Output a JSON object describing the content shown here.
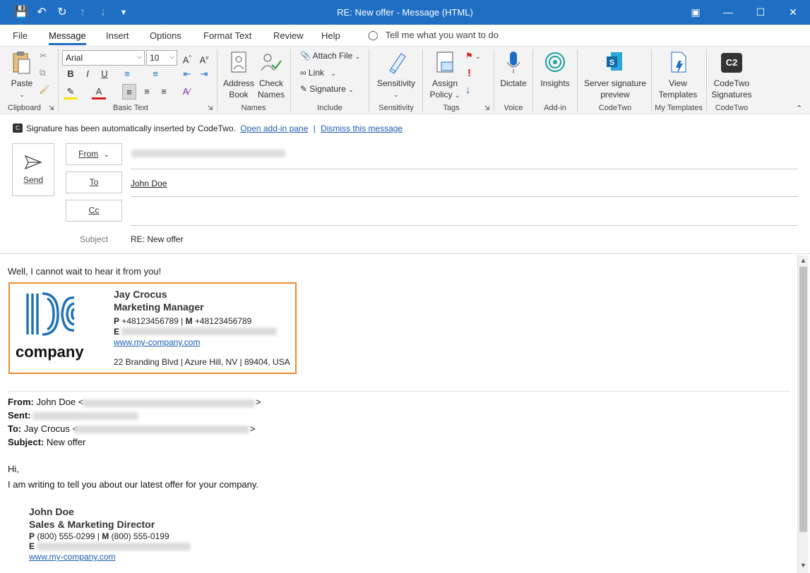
{
  "window": {
    "title": "RE: New offer  -  Message (HTML)"
  },
  "tabs": [
    "File",
    "Message",
    "Insert",
    "Options",
    "Format Text",
    "Review",
    "Help"
  ],
  "tell_me": "Tell me what you want to do",
  "ribbon": {
    "clipboard": {
      "paste": "Paste",
      "group": "Clipboard"
    },
    "basic_text": {
      "font": "Arial",
      "size": "10",
      "group": "Basic Text",
      "bold": "B",
      "italic": "I",
      "underline": "U"
    },
    "names": {
      "address_book_1": "Address",
      "address_book_2": "Book",
      "check_names_1": "Check",
      "check_names_2": "Names",
      "group": "Names"
    },
    "include": {
      "attach_file": "Attach File",
      "link": "Link",
      "signature": "Signature",
      "group": "Include"
    },
    "sensitivity": {
      "label": "Sensitivity",
      "group": "Sensitivity"
    },
    "tags": {
      "assign_1": "Assign",
      "assign_2": "Policy",
      "group": "Tags"
    },
    "voice": {
      "dictate": "Dictate",
      "group": "Voice"
    },
    "addin": {
      "insights": "Insights",
      "group": "Add-in"
    },
    "codetwo": {
      "preview_1": "Server signature",
      "preview_2": "preview",
      "group": "CodeTwo"
    },
    "mytemplates": {
      "view_1": "View",
      "view_2": "Templates",
      "group": "My Templates"
    },
    "codetwo2": {
      "sig_1": "CodeTwo",
      "sig_2": "Signatures",
      "group": "CodeTwo",
      "logo": "C2"
    }
  },
  "infobar": {
    "message": "Signature has been automatically inserted by CodeTwo.",
    "open_link": "Open add-in pane",
    "sep": "|",
    "dismiss_link": "Dismiss this message"
  },
  "compose": {
    "send": "Send",
    "from": "From",
    "to": "To",
    "cc": "Cc",
    "to_value": "John Doe",
    "subject_label": "Subject",
    "subject_value": "RE: New offer"
  },
  "body": {
    "greeting_line": "Well, I cannot wait to hear it from you!",
    "signature": {
      "logo_text": "company",
      "name": "Jay Crocus",
      "title": "Marketing Manager",
      "p_label": "P",
      "phone": "+48123456789",
      "m_label": "M",
      "mobile": "+48123456789",
      "e_label": "E",
      "website": "www.my-company.com",
      "address": "22 Branding Blvd | Azure Hill, NV | 89404, USA"
    },
    "quoted": {
      "from_label": "From:",
      "from_value": "John Doe <",
      "sent_label": "Sent:",
      "to_label": "To:",
      "to_value": "Jay Crocus <",
      "close": ">",
      "subject_label": "Subject:",
      "subject_value": "New offer",
      "hi": "Hi,",
      "text": "I am writing to tell you about our latest offer for your company.",
      "sig_name": "John Doe",
      "sig_title": "Sales & Marketing Director",
      "p_label": "P",
      "phone": "(800) 555-0299",
      "m_label": "M",
      "mobile": "(800) 555-0199",
      "e_label": "E",
      "website": "www.my-company.com"
    }
  },
  "colors": {
    "titlebar": "#1e6fc4",
    "accent": "#1e6fc4",
    "signature_border": "#ee8a2d",
    "link": "#1e5fb0"
  }
}
